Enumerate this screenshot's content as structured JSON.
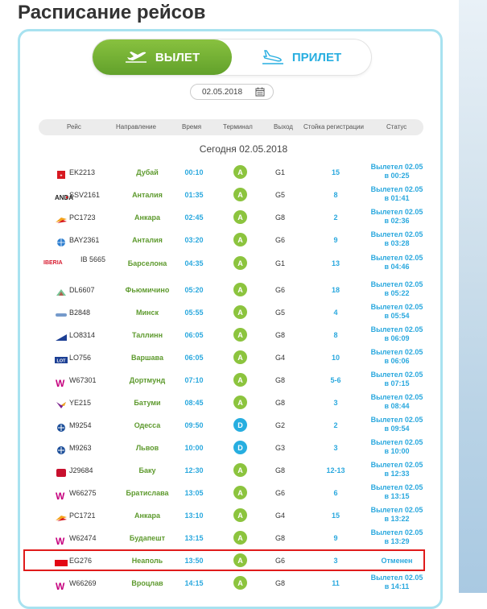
{
  "page": {
    "title": "Расписание рейсов"
  },
  "tabs": {
    "departures": "ВЫЛЕТ",
    "arrivals": "ПРИЛЕТ"
  },
  "date": {
    "value": "02.05.2018"
  },
  "table": {
    "headers": [
      "Рейс",
      "Направление",
      "Время",
      "Терминал",
      "Выход",
      "Стойка регистрации",
      "Статус"
    ],
    "today_label": "Сегодня 02.05.2018",
    "rows": [
      {
        "logo": "emirates",
        "logo_text": "",
        "flight": "EK2213",
        "dest": "Дубай",
        "time": "00:10",
        "term": "A",
        "gate": "G1",
        "counter": "15",
        "s1": "Вылетел 02.05",
        "s2": "в 00:25"
      },
      {
        "logo": "anadolujet",
        "logo_text": "ANDA",
        "flight": "SSV2161",
        "dest": "Анталия",
        "time": "01:35",
        "term": "A",
        "gate": "G5",
        "counter": "8",
        "s1": "Вылетел 02.05",
        "s2": "в 01:41"
      },
      {
        "logo": "pegasus",
        "logo_text": "",
        "flight": "PC1723",
        "dest": "Анкара",
        "time": "02:45",
        "term": "A",
        "gate": "G8",
        "counter": "2",
        "s1": "Вылетел 02.05",
        "s2": "в 02:36"
      },
      {
        "logo": "globe",
        "logo_text": "",
        "flight": "BAY2361",
        "dest": "Анталия",
        "time": "03:20",
        "term": "A",
        "gate": "G6",
        "counter": "9",
        "s1": "Вылетел 02.05",
        "s2": "в 03:28"
      },
      {
        "logo": "iberia",
        "logo_text": "IBERIA",
        "flight": "IB 5665",
        "dest": "Барселона",
        "time": "04:35",
        "term": "A",
        "gate": "G1",
        "counter": "13",
        "s1": "Вылетел 02.05",
        "s2": "в 04:46"
      },
      {
        "logo": "alitalia",
        "logo_text": "",
        "flight": "DL6607",
        "dest": "Фьюмичино",
        "time": "05:20",
        "term": "A",
        "gate": "G6",
        "counter": "18",
        "s1": "Вылетел 02.05",
        "s2": "в 05:22"
      },
      {
        "logo": "belavia",
        "logo_text": "",
        "flight": "B2848",
        "dest": "Минск",
        "time": "05:55",
        "term": "A",
        "gate": "G5",
        "counter": "4",
        "s1": "Вылетел 02.05",
        "s2": "в 05:54"
      },
      {
        "logo": "lot-blue",
        "logo_text": "",
        "flight": "LO8314",
        "dest": "Таллинн",
        "time": "06:05",
        "term": "A",
        "gate": "G8",
        "counter": "8",
        "s1": "Вылетел 02.05",
        "s2": "в 06:09"
      },
      {
        "logo": "lot",
        "logo_text": "LOT",
        "flight": "LO756",
        "dest": "Варшава",
        "time": "06:05",
        "term": "A",
        "gate": "G4",
        "counter": "10",
        "s1": "Вылетел 02.05",
        "s2": "в 06:06"
      },
      {
        "logo": "wizz",
        "logo_text": "W",
        "flight": "W67301",
        "dest": "Дортмунд",
        "time": "07:10",
        "term": "A",
        "gate": "G8",
        "counter": "5-6",
        "s1": "Вылетел 02.05",
        "s2": "в 07:15"
      },
      {
        "logo": "yanair",
        "logo_text": "",
        "flight": "YE215",
        "dest": "Батуми",
        "time": "08:45",
        "term": "A",
        "gate": "G8",
        "counter": "3",
        "s1": "Вылетел 02.05",
        "s2": "в 08:44"
      },
      {
        "logo": "mau",
        "logo_text": "",
        "flight": "M9254",
        "dest": "Одесса",
        "time": "09:50",
        "term": "D",
        "gate": "G2",
        "counter": "2",
        "s1": "Вылетел 02.05",
        "s2": "в 09:54"
      },
      {
        "logo": "mau",
        "logo_text": "",
        "flight": "M9263",
        "dest": "Львов",
        "time": "10:00",
        "term": "D",
        "gate": "G3",
        "counter": "3",
        "s1": "Вылетел 02.05",
        "s2": "в 10:00"
      },
      {
        "logo": "azal",
        "logo_text": "",
        "flight": "J29684",
        "dest": "Баку",
        "time": "12:30",
        "term": "A",
        "gate": "G8",
        "counter": "12-13",
        "s1": "Вылетел 02.05",
        "s2": "в 12:33"
      },
      {
        "logo": "wizz",
        "logo_text": "W",
        "flight": "W66275",
        "dest": "Братислава",
        "time": "13:05",
        "term": "A",
        "gate": "G6",
        "counter": "6",
        "s1": "Вылетел 02.05",
        "s2": "в 13:15"
      },
      {
        "logo": "pegasus",
        "logo_text": "",
        "flight": "PC1721",
        "dest": "Анкара",
        "time": "13:10",
        "term": "A",
        "gate": "G4",
        "counter": "15",
        "s1": "Вылетел 02.05",
        "s2": "в 13:22"
      },
      {
        "logo": "wizz",
        "logo_text": "W",
        "flight": "W62474",
        "dest": "Будапешт",
        "time": "13:15",
        "term": "A",
        "gate": "G8",
        "counter": "9",
        "s1": "Вылетел 02.05",
        "s2": "в 13:29"
      },
      {
        "logo": "egyptair",
        "logo_text": "",
        "flight": "EG276",
        "dest": "Неаполь",
        "time": "13:50",
        "term": "A",
        "gate": "G6",
        "counter": "3",
        "s1": "Отменен",
        "s2": ""
      },
      {
        "logo": "wizz",
        "logo_text": "W",
        "flight": "W66269",
        "dest": "Вроцлав",
        "time": "14:15",
        "term": "A",
        "gate": "G8",
        "counter": "11",
        "s1": "Вылетел 02.05",
        "s2": "в 14:11"
      }
    ]
  },
  "colors": {
    "green": "#6aa82f",
    "blue": "#27aee0",
    "border": "#a8e2f0",
    "highlight": "#e01b1b"
  }
}
